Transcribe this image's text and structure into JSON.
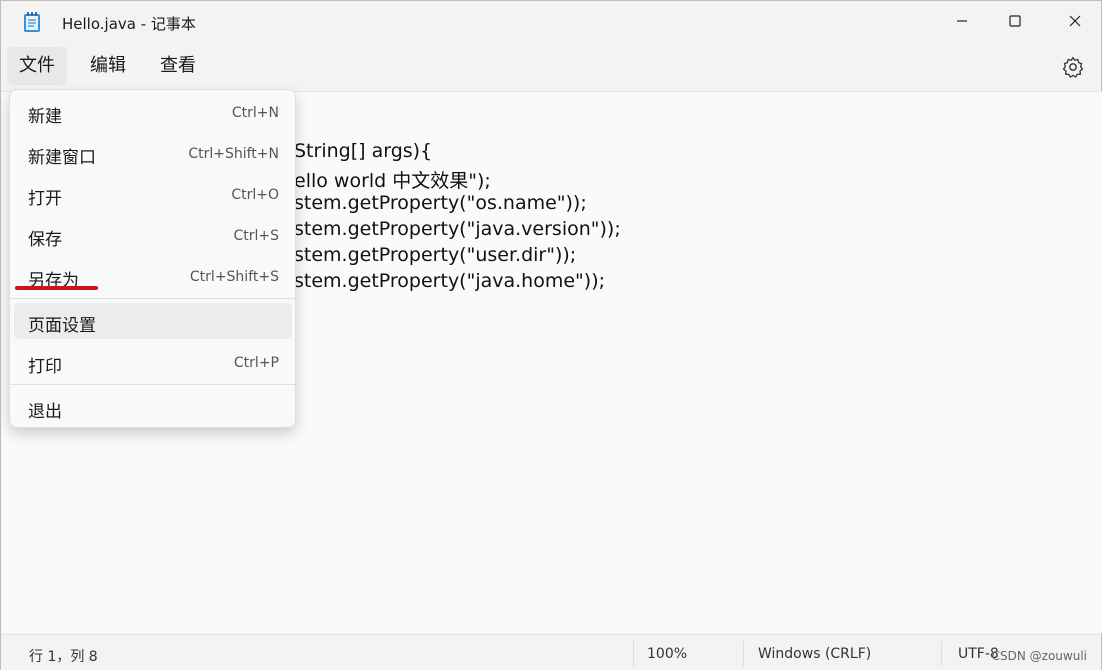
{
  "window": {
    "title": "Hello.java - 记事本"
  },
  "menubar": {
    "file": "文件",
    "edit": "编辑",
    "view": "查看"
  },
  "file_menu": {
    "items": [
      {
        "label": "新建",
        "shortcut": "Ctrl+N"
      },
      {
        "label": "新建窗口",
        "shortcut": "Ctrl+Shift+N"
      },
      {
        "label": "打开",
        "shortcut": "Ctrl+O"
      },
      {
        "label": "保存",
        "shortcut": "Ctrl+S"
      },
      {
        "label": "另存为",
        "shortcut": "Ctrl+Shift+S"
      },
      {
        "label": "页面设置",
        "shortcut": ""
      },
      {
        "label": "打印",
        "shortcut": "Ctrl+P"
      },
      {
        "label": "退出",
        "shortcut": ""
      }
    ],
    "highlighted_color": "#d0131a"
  },
  "editor": {
    "visible_lines": [
      "String[] args){",
      "ello world 中文效果\");",
      "stem.getProperty(\"os.name\"));",
      "stem.getProperty(\"java.version\"));",
      "stem.getProperty(\"user.dir\"));",
      "stem.getProperty(\"java.home\"));"
    ]
  },
  "statusbar": {
    "position": "行 1，列 8",
    "zoom": "100%",
    "line_ending": "Windows (CRLF)",
    "encoding": "UTF-8",
    "watermark": "CSDN @zouwuli"
  },
  "icons": {
    "app": "notepad-icon",
    "minimize": "minimize-icon",
    "maximize": "maximize-icon",
    "close": "close-icon",
    "settings": "gear-icon"
  }
}
